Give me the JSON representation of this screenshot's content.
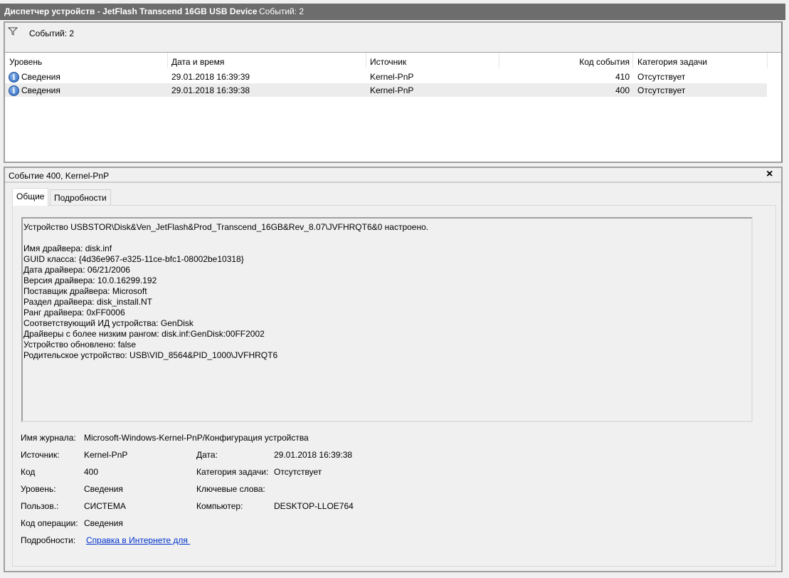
{
  "window": {
    "title": "Диспетчер устройств - JetFlash Transcend 16GB USB Device",
    "count": "Событий: 2"
  },
  "filter_bar": {
    "icon": "filter-icon",
    "count": "Событий: 2"
  },
  "columns": [
    "Уровень",
    "Дата и время",
    "Источник",
    "Код события",
    "Категория задачи"
  ],
  "rows": [
    {
      "level": "Сведения",
      "datetime": "29.01.2018 16:39:39",
      "source": "Kernel-PnP",
      "code": "410",
      "category": "Отсутствует",
      "selected": false
    },
    {
      "level": "Сведения",
      "datetime": "29.01.2018 16:39:38",
      "source": "Kernel-PnP",
      "code": "400",
      "category": "Отсутствует",
      "selected": true
    }
  ],
  "detail": {
    "title": "Событие 400, Kernel-PnP",
    "close": "×",
    "tabs": [
      "Общие",
      "Подробности"
    ],
    "message": [
      "Устройство USBSTOR\\Disk&Ven_JetFlash&Prod_Transcend_16GB&Rev_8.07\\JVFHRQT6&0 настроено.",
      "",
      "Имя драйвера: disk.inf",
      "GUID класса: {4d36e967-e325-11ce-bfc1-08002be10318}",
      "Дата драйвера: 06/21/2006",
      "Версия драйвера: 10.0.16299.192",
      "Поставщик драйвера: Microsoft",
      "Раздел драйвера: disk_install.NT",
      "Ранг драйвера: 0xFF0006",
      "Соответствующий ИД устройства: GenDisk",
      "Драйверы с более низким рангом: disk.inf:GenDisk:00FF2002",
      "Устройство обновлено: false",
      "Родительское устройство: USB\\VID_8564&PID_1000\\JVFHRQT6"
    ],
    "fields": {
      "log_label": "Имя журнала:",
      "log": "Microsoft-Windows-Kernel-PnP/Конфигурация устройства",
      "source_label": "Источник:",
      "source": "Kernel-PnP",
      "date_label": "Дата:",
      "date": "29.01.2018 16:39:38",
      "code_label": "Код",
      "code": "400",
      "category_label": "Категория задачи:",
      "category": "Отсутствует",
      "level_label": "Уровень:",
      "level": "Сведения",
      "keywords_label": "Ключевые слова:",
      "user_label": "Пользов.:",
      "user": "СИСТЕМА",
      "computer_label": "Компьютер:",
      "computer": "DESKTOP-LLOE764",
      "opcode_label": "Код операции:",
      "opcode": "Сведения",
      "more_label": "Подробности:",
      "more_link": "Справка в Интернете для "
    }
  }
}
